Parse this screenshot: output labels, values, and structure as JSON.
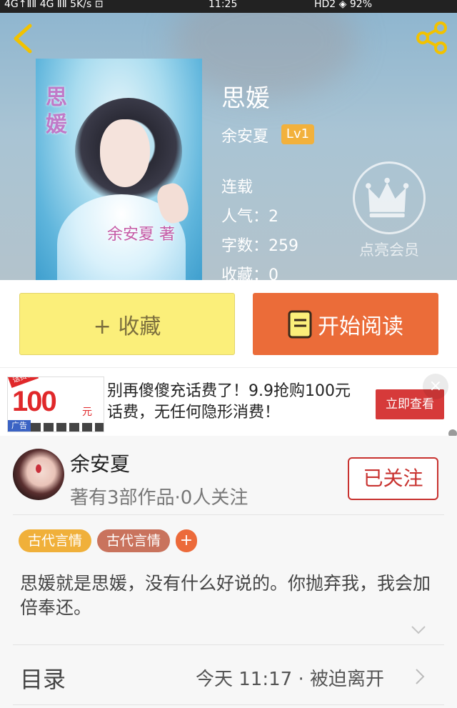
{
  "status_bar": {
    "left": "4G↑ⅡⅡ 4G ⅡⅡ 5K/s ⊡",
    "time": "11:25",
    "right": "HD2 ◈ 92%"
  },
  "book": {
    "title": "思媛",
    "author": "余安夏",
    "level": "Lv1",
    "status": "连载",
    "popularity_label": "人气：",
    "popularity": "2",
    "words_label": "字数：",
    "words": "259",
    "favorites_label": "收藏：",
    "favorites": "0",
    "cover_title": "思媛",
    "cover_author": "余安夏 著"
  },
  "vip": {
    "label": "点亮会员",
    "icon": "crown-icon"
  },
  "actions": {
    "collect": "+ 收藏",
    "read": "开始阅读"
  },
  "ad": {
    "text": "别再傻傻充话费了！9.9抢购100元话费，无任何隐形消费！",
    "button": "立即查看",
    "image_amount": "100",
    "image_unit": "元",
    "image_top_tag": "话费包",
    "tag": "广告",
    "close": "×"
  },
  "author_card": {
    "name": "余安夏",
    "meta": "著有3部作品·0人关注",
    "follow": "已关注"
  },
  "tags": [
    "古代言情",
    "古代言情",
    "+"
  ],
  "description": "思媛就是思媛，没有什么好说的。你抛弃我，我会加倍奉还。",
  "toc": {
    "label": "目录",
    "latest": "今天 11:17 · 被迫离开"
  },
  "colors": {
    "accent_orange": "#eb6c39",
    "collect_yellow": "#fbef7a",
    "follow_red": "#c8322f",
    "level_badge": "#f2b13c"
  }
}
